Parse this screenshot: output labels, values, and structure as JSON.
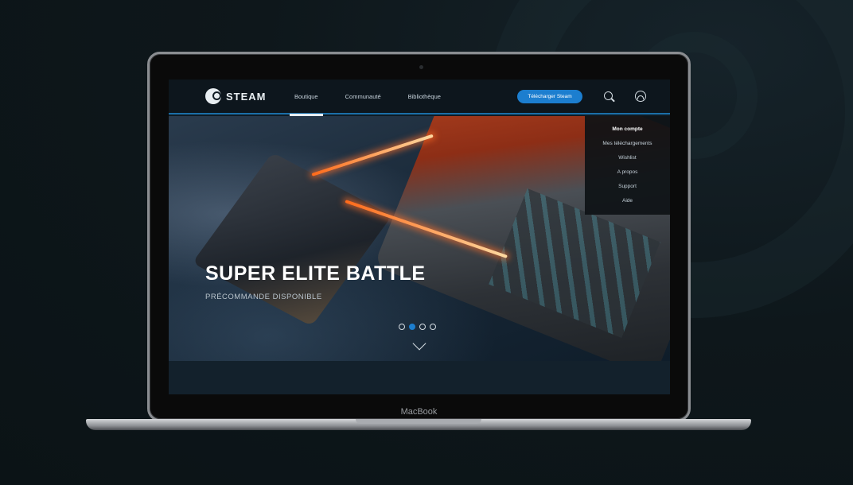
{
  "device": {
    "label": "MacBook"
  },
  "nav": {
    "brand": "STEAM",
    "links": [
      {
        "label": "Boutique",
        "active": true
      },
      {
        "label": "Communauté",
        "active": false
      },
      {
        "label": "Bibliothèque",
        "active": false
      }
    ],
    "download_button": "Télécharger Steam",
    "icons": [
      "search-icon",
      "account-icon"
    ]
  },
  "account_menu": {
    "items": [
      "Mon compte",
      "Mes téléchargements",
      "Wishlist",
      "A propos",
      "Support",
      "Aide"
    ]
  },
  "hero": {
    "title": "SUPER ELITE BATTLE",
    "subtitle": "PRÉCOMMANDE DISPONIBLE",
    "carousel": {
      "count": 4,
      "active_index": 1
    }
  },
  "colors": {
    "accent": "#1c7ecf",
    "background": "#0d1518"
  }
}
